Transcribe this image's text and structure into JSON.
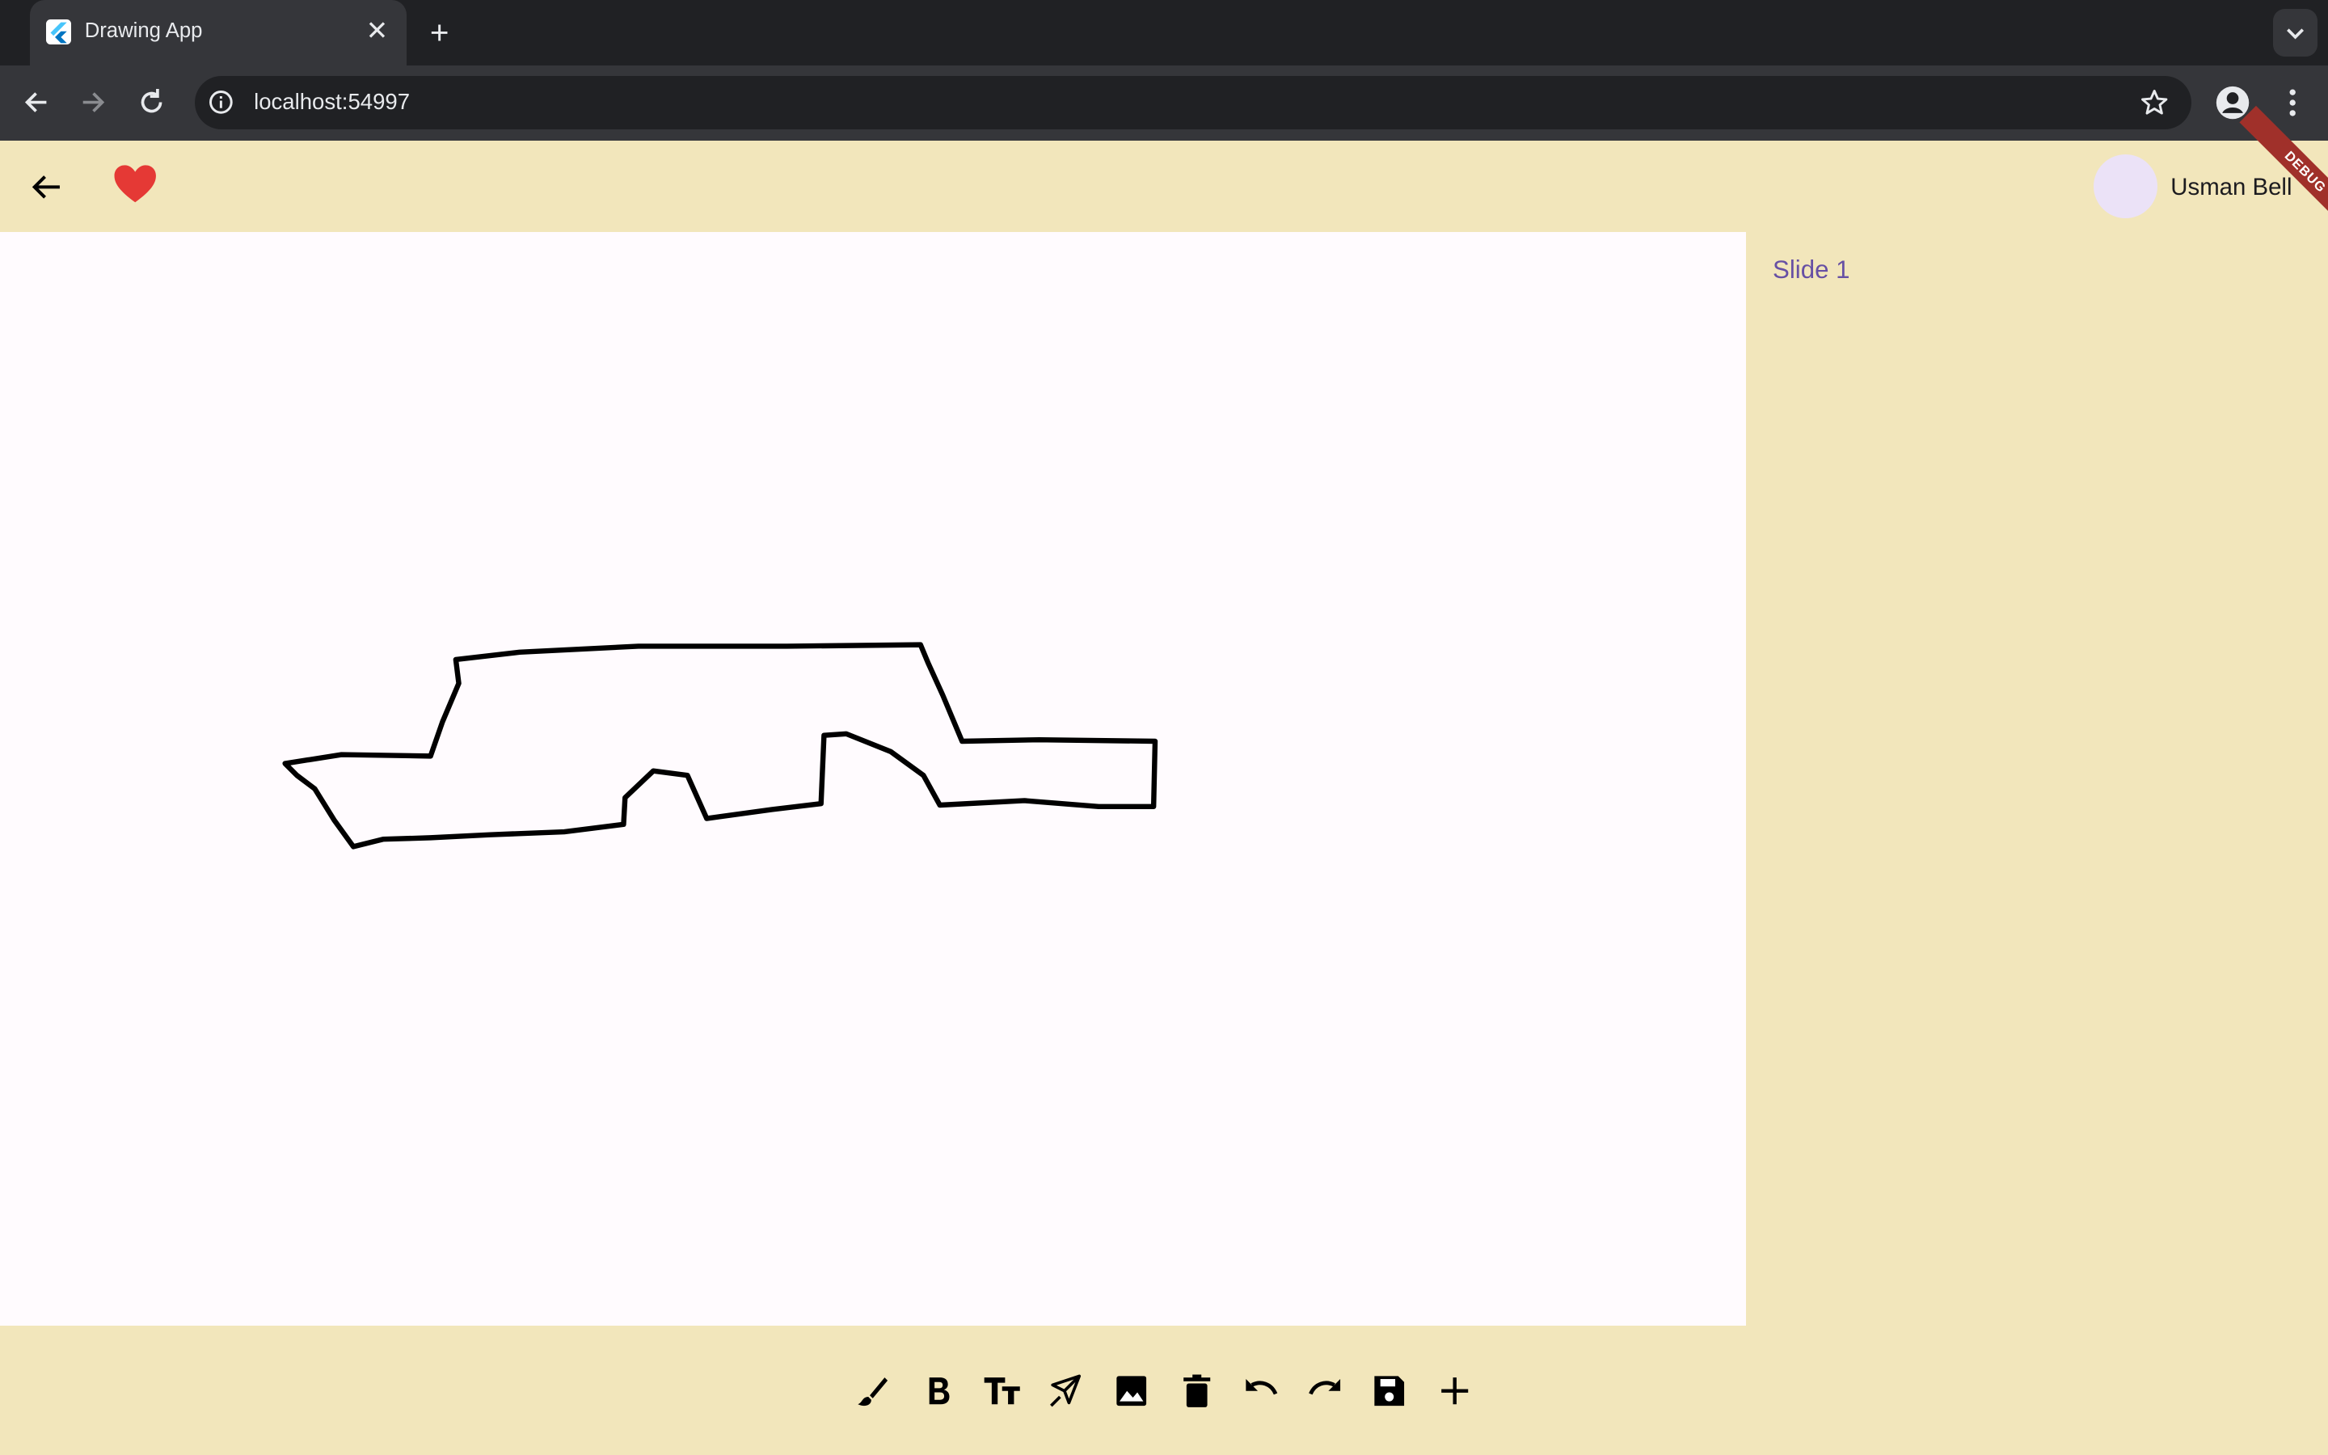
{
  "browser": {
    "tab_title": "Drawing App",
    "url": "localhost:54997"
  },
  "app": {
    "user_name": "Usman Bell",
    "debug_label": "DEBUG",
    "slides": [
      {
        "label": "Slide 1"
      }
    ],
    "tools": [
      "brush-icon",
      "bold-icon",
      "text-size-icon",
      "eraser-icon",
      "image-icon",
      "delete-icon",
      "undo-icon",
      "redo-icon",
      "save-icon",
      "add-icon"
    ]
  },
  "colors": {
    "app_background": "#f2e6bb",
    "canvas_background": "#fffbfe",
    "accent": "#6750a4",
    "heart": "#e53935",
    "stroke": "#000000"
  }
}
